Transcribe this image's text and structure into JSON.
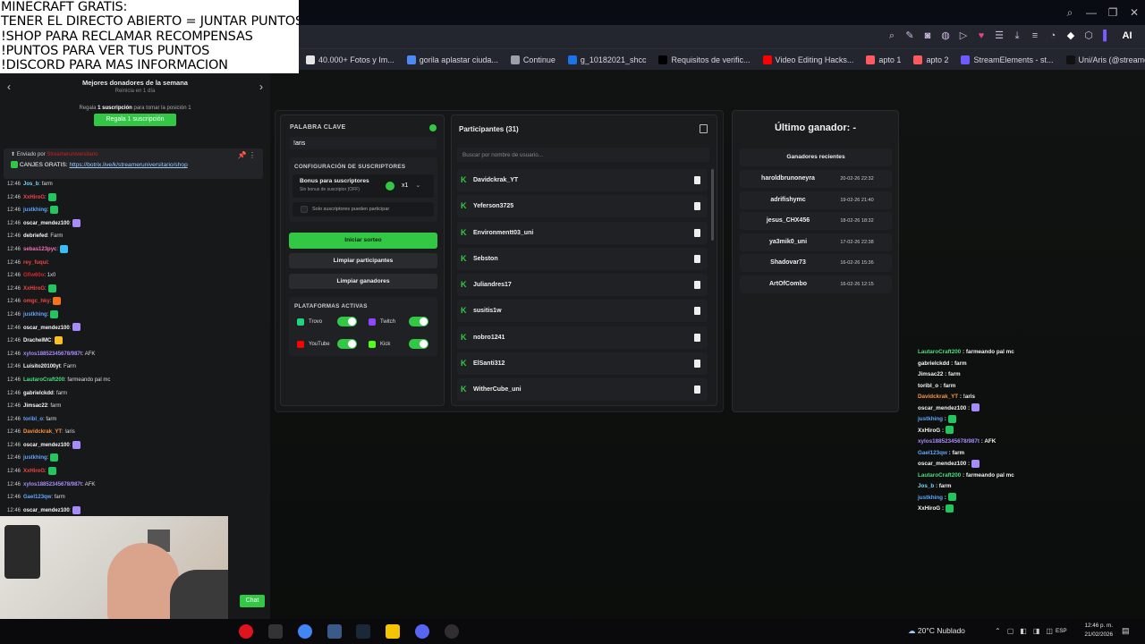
{
  "overlay": {
    "lines": [
      "MINECRAFT GRATIS:",
      "TENER EL DIRECTO ABIERTO = JUNTAR PUNTOS",
      "!SHOP PARA RECLAMAR RECOMPENSAS",
      "!PUNTOS PARA VER TUS PUNTOS",
      "!DISCORD PARA MAS INFORMACION"
    ]
  },
  "browser": {
    "bookmarks": [
      {
        "label": "40.000+ Fotos y Im...",
        "color": "#e6e6e6"
      },
      {
        "label": "gorila aplastar ciuda...",
        "color": "#4c8bf5"
      },
      {
        "label": "Continue",
        "color": "#9aa0a6"
      },
      {
        "label": "g_10182021_shcc",
        "color": "#1a73e8"
      },
      {
        "label": "Requisitos de verific...",
        "color": "#000000"
      },
      {
        "label": "Video Editing Hacks...",
        "color": "#ff0000"
      },
      {
        "label": "apto 1",
        "color": "#ff5a5f"
      },
      {
        "label": "apto 2",
        "color": "#ff5a5f"
      },
      {
        "label": "StreamElements - st...",
        "color": "#6e5bff"
      },
      {
        "label": "Uni/Aris (@streame...",
        "color": "#111111"
      }
    ],
    "ai_label": "AI"
  },
  "left_panel": {
    "donors_title": "Mejores donadores de la semana",
    "donors_sub": "Reinicia en 1 día",
    "gift_prefix": "Regala",
    "gift_bold": "1 suscripción",
    "gift_suffix": "para tomar la posición 1",
    "gift_button": "Regala 1 suscripción",
    "pinned_by": "Enviado por",
    "pinned_user": "Streameruniversitario",
    "pinned_text": "CANJES GRATIS:",
    "pinned_link": "https://botrix.live/k/streameruniversitario/shop",
    "chat_button": "Chat"
  },
  "chat": [
    {
      "ts": "12:46",
      "user": "Jos_b",
      "color": "#7dd3fc",
      "msg": ": farm"
    },
    {
      "ts": "12:46",
      "user": "XxHiroG",
      "color": "#ef4444",
      "msg": ":",
      "emote": "#22c55e"
    },
    {
      "ts": "12:46",
      "user": "justkhing",
      "color": "#60a5fa",
      "msg": ":",
      "emote": "#22c55e"
    },
    {
      "ts": "12:46",
      "user": "oscar_mendez100",
      "color": "#f5f5f5",
      "msg": ":",
      "emote": "#a78bfa"
    },
    {
      "ts": "12:46",
      "user": "debriefed",
      "color": "#f5f5f5",
      "msg": ": Farm"
    },
    {
      "ts": "12:46",
      "user": "sebas123pyc",
      "color": "#f472b6",
      "msg": ":",
      "emote": "#38bdf8"
    },
    {
      "ts": "12:46",
      "user": "rey_fuqui",
      "color": "#ef4444",
      "msg": ":"
    },
    {
      "ts": "12:46",
      "user": "Gfiw60o",
      "color": "#dc2626",
      "msg": ": 1x0"
    },
    {
      "ts": "12:46",
      "user": "XxHiroG",
      "color": "#ef4444",
      "msg": ":",
      "emote": "#22c55e"
    },
    {
      "ts": "12:46",
      "user": "omgc_hky",
      "color": "#ef4444",
      "msg": ":",
      "emote": "#f97316"
    },
    {
      "ts": "12:46",
      "user": "justkhing",
      "color": "#60a5fa",
      "msg": ":",
      "emote": "#22c55e"
    },
    {
      "ts": "12:46",
      "user": "oscar_mendez100",
      "color": "#f5f5f5",
      "msg": ":",
      "emote": "#a78bfa"
    },
    {
      "ts": "12:46",
      "user": "DrachelMC",
      "color": "#f5f5f5",
      "msg": ":",
      "emote": "#fbbf24"
    },
    {
      "ts": "12:46",
      "user": "xylos18852345678/987t",
      "color": "#a78bfa",
      "msg": ": AFK"
    },
    {
      "ts": "12:46",
      "user": "Luisito20100yt",
      "color": "#f5f5f5",
      "msg": ": Farm"
    },
    {
      "ts": "12:46",
      "user": "LautaroCraft200",
      "color": "#4ade80",
      "msg": ": farmeando pal mc"
    },
    {
      "ts": "12:46",
      "user": "gabrielckdd",
      "color": "#f5f5f5",
      "msg": ": farm"
    },
    {
      "ts": "12:46",
      "user": "Jimsac22",
      "color": "#f5f5f5",
      "msg": ": farm"
    },
    {
      "ts": "12:46",
      "user": "toribl_o",
      "color": "#60a5fa",
      "msg": ": farm"
    },
    {
      "ts": "12:46",
      "user": "Davidckrak_YT",
      "color": "#fb923c",
      "msg": ": !aris"
    },
    {
      "ts": "12:46",
      "user": "oscar_mendez100",
      "color": "#f5f5f5",
      "msg": ":",
      "emote": "#a78bfa"
    },
    {
      "ts": "12:46",
      "user": "justkhing",
      "color": "#60a5fa",
      "msg": ":",
      "emote": "#22c55e"
    },
    {
      "ts": "12:46",
      "user": "XxHiroG",
      "color": "#ef4444",
      "msg": ":",
      "emote": "#22c55e"
    },
    {
      "ts": "12:46",
      "user": "xylos18852345678/987t",
      "color": "#a78bfa",
      "msg": ": AFK"
    },
    {
      "ts": "12:46",
      "user": "Gael123qw",
      "color": "#60a5fa",
      "msg": ": farm"
    },
    {
      "ts": "12:46",
      "user": "oscar_mendez100",
      "color": "#f5f5f5",
      "msg": ":",
      "emote": "#a78bfa"
    }
  ],
  "raffle": {
    "keyword_label": "PALABRA CLAVE",
    "keyword_value": "!aris",
    "sub_config_title": "CONFIGURACIÓN DE SUSCRIPTORES",
    "bonus_title": "Bonus para suscriptores",
    "bonus_sub": "Sin bonus de suscriptor (OFF)",
    "bonus_value": "x1",
    "only_subs": "Solo suscriptores pueden participar",
    "start_button": "Iniciar sorteo",
    "clear_participants": "Limpiar participantes",
    "clear_winners": "Limpiar ganadores",
    "platforms_title": "PLATAFORMAS ACTIVAS",
    "platforms": [
      {
        "name": "Trovo",
        "color": "#1fd27f"
      },
      {
        "name": "Twitch",
        "color": "#9146ff"
      },
      {
        "name": "YouTube",
        "color": "#ff0000"
      },
      {
        "name": "Kick",
        "color": "#53fc18"
      }
    ]
  },
  "participants": {
    "title": "Participantes (31)",
    "search_placeholder": "Buscar por nombre de usuario...",
    "list": [
      "Davidckrak_YT",
      "Yeferson3725",
      "Environmentt03_uni",
      "Sebston",
      "Juliandres17",
      "susitis1w",
      "nobro1241",
      "ElSanti312",
      "WitherCube_uni"
    ]
  },
  "winners": {
    "last_winner": "Último ganador: -",
    "recent_title": "Ganadores recientes",
    "list": [
      {
        "name": "haroldbrunoneyra",
        "date": "20-02-26 22:32"
      },
      {
        "name": "adrifishymc",
        "date": "19-02-26 21:40"
      },
      {
        "name": "jesus_CHX456",
        "date": "18-02-26 18:32"
      },
      {
        "name": "ya3mik0_uni",
        "date": "17-02-26 22:38"
      },
      {
        "name": "Shadovar73",
        "date": "16-02-26 15:36"
      },
      {
        "name": "ArtOfCombo",
        "date": "16-02-26 12:15"
      }
    ]
  },
  "right_chat": [
    {
      "user": "LautaroCraft200",
      "color": "#4ade80",
      "msg": " : farmeando pal mc"
    },
    {
      "user": "gabrielckdd",
      "color": "#f5f5f5",
      "msg": " : farm"
    },
    {
      "user": "Jimsac22",
      "color": "#f5f5f5",
      "msg": " : farm"
    },
    {
      "user": "toribl_o",
      "color": "#f5f5f5",
      "msg": " : farm"
    },
    {
      "user": "Davidckrak_YT",
      "color": "#fb923c",
      "msg": " : !aris"
    },
    {
      "user": "oscar_mendez100",
      "color": "#f5f5f5",
      "msg": " :",
      "emote": "#a78bfa"
    },
    {
      "user": "justkhing",
      "color": "#60a5fa",
      "msg": " :",
      "emote": "#22c55e"
    },
    {
      "user": "XxHiroG",
      "color": "#f5f5f5",
      "msg": " :",
      "emote": "#22c55e"
    },
    {
      "user": "xylos18852345678/987t",
      "color": "#a78bfa",
      "msg": " : AFK"
    },
    {
      "user": "Gael123qw",
      "color": "#60a5fa",
      "msg": " : farm"
    },
    {
      "user": "oscar_mendez100",
      "color": "#f5f5f5",
      "msg": " :",
      "emote": "#a78bfa"
    },
    {
      "user": "LautaroCraft200",
      "color": "#4ade80",
      "msg": " : farmeando pal mc"
    },
    {
      "user": "Jos_b",
      "color": "#7dd3fc",
      "msg": " : farm"
    },
    {
      "user": "justkhing",
      "color": "#60a5fa",
      "msg": " :",
      "emote": "#22c55e"
    },
    {
      "user": "XxHiroG",
      "color": "#f5f5f5",
      "msg": " :",
      "emote": "#22c55e"
    }
  ],
  "taskbar": {
    "apps": [
      {
        "name": "opera-icon",
        "color": "#e0141e"
      },
      {
        "name": "streamer-app-icon",
        "color": "#333333"
      },
      {
        "name": "chrome-icon",
        "color": "#4285f4"
      },
      {
        "name": "files-icon",
        "color": "#3a5a8a"
      },
      {
        "name": "steam-icon",
        "color": "#1b2838"
      },
      {
        "name": "app-yellow-icon",
        "color": "#f5c400"
      },
      {
        "name": "discord-icon",
        "color": "#5865f2"
      },
      {
        "name": "obs-icon",
        "color": "#302e31"
      }
    ],
    "weather": "20°C  Nublado",
    "lang": "ESP",
    "time": "12:46 p. m.",
    "date": "21/02/2026"
  }
}
